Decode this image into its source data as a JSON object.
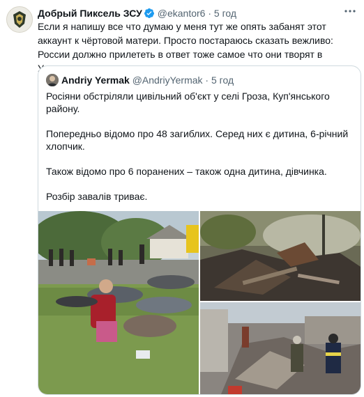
{
  "tweet": {
    "author_name": "Добрый Пиксель ЗСУ",
    "author_handle": "@ekantor6",
    "separator": "·",
    "time": "5 год",
    "text": "Если я напишу все что думаю у меня тут же опять забанят этот аккаунт к чёртовой матери. Просто постараюсь сказать вежливо: России должно прилететь в ответ тоже самое что они творят в Украине."
  },
  "quoted": {
    "author_name": "Andriy Yermak",
    "author_handle": "@AndriyYermak",
    "separator": "·",
    "time": "5 год",
    "paragraphs": [
      "Росіяни обстріляли цивільний об'єкт у селі Гроза, Куп'янського району.",
      "Попередньо відомо про 48 загиблих. Серед них є дитина, 6-річний хлопчик.",
      "Також відомо про 6 поранених – також одна дитина, дівчинка.",
      "Розбір завалів триває."
    ]
  },
  "icons": {
    "verified": "verified-badge-icon",
    "more": "more-options-icon"
  },
  "colors": {
    "verified_blue": "#1d9bf0",
    "secondary_text": "#536471",
    "border": "#cfd9de"
  }
}
